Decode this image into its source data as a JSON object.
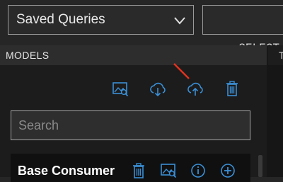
{
  "saved_queries": {
    "label": "Saved Queries",
    "icon": "chevron-down-icon"
  },
  "sql_editor": {
    "text": "SELECT *"
  },
  "tabs": {
    "models": "MODELS",
    "right": "T"
  },
  "toolbar": {
    "icons": [
      "image-search-icon",
      "cloud-download-icon",
      "cloud-upload-icon",
      "trash-icon"
    ],
    "accent": "#3a8fd6"
  },
  "search": {
    "placeholder": "Search",
    "value": ""
  },
  "model_card": {
    "title": "Base Consumer",
    "icons": [
      "trash-icon",
      "image-search-icon",
      "info-icon",
      "add-circle-icon"
    ]
  },
  "annotation": {
    "color": "#e0321f"
  }
}
